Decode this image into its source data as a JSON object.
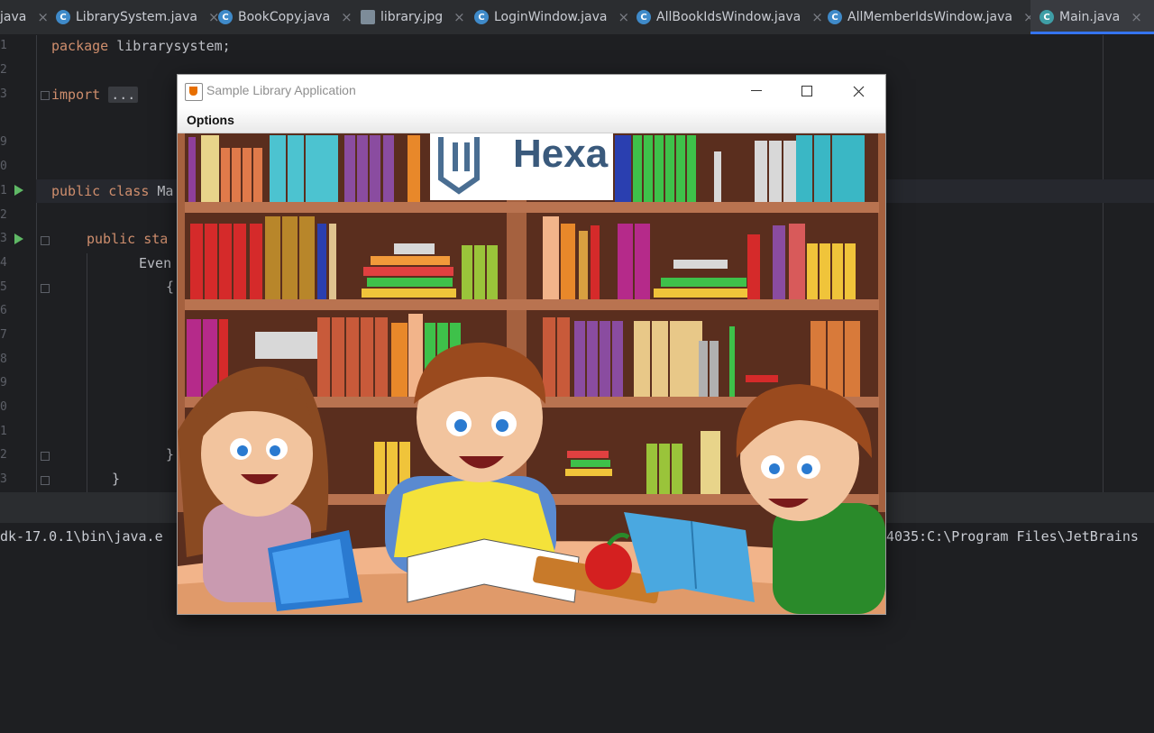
{
  "ide": {
    "tabs": [
      {
        "label": "java",
        "icon": "none"
      },
      {
        "label": "LibrarySystem.java",
        "icon": "java-class-icon"
      },
      {
        "label": "BookCopy.java",
        "icon": "java-class-icon"
      },
      {
        "label": "library.jpg",
        "icon": "image-file-icon"
      },
      {
        "label": "LoginWindow.java",
        "icon": "java-class-icon"
      },
      {
        "label": "AllBookIdsWindow.java",
        "icon": "java-class-icon"
      },
      {
        "label": "AllMemberIdsWindow.java",
        "icon": "java-class-icon"
      },
      {
        "label": "Main.java",
        "icon": "java-main-class-icon",
        "active": true
      }
    ],
    "line_numbers": [
      "1",
      "2",
      "3",
      "9",
      "0",
      "1",
      "2",
      "3",
      "4",
      "5",
      "6",
      "7",
      "8",
      "9",
      "0",
      "1",
      "2",
      "3"
    ],
    "code": {
      "line1_kw": "package",
      "line1_rest": " librarysystem;",
      "import_kw": "import",
      "import_rest": "...",
      "class_kw": "public class",
      "class_rest": " Ma",
      "method_kw": "public sta",
      "event_text": "Even",
      "brace_open": "{",
      "brace_close_inner": "}",
      "brace_close_outer": "}"
    },
    "console": {
      "left_text": "dk-17.0.1\\bin\\java.e",
      "right_text": "4035:C:\\Program Files\\JetBrains"
    },
    "colors": {
      "accent": "#3574f0",
      "keyword": "#cf8e6d",
      "run": "#5fb865"
    }
  },
  "window": {
    "title": "Sample Library Application",
    "menu": [
      "Options"
    ],
    "controls": [
      "minimize-icon",
      "maximize-icon",
      "close-icon"
    ],
    "logo_text": "Hexa"
  }
}
